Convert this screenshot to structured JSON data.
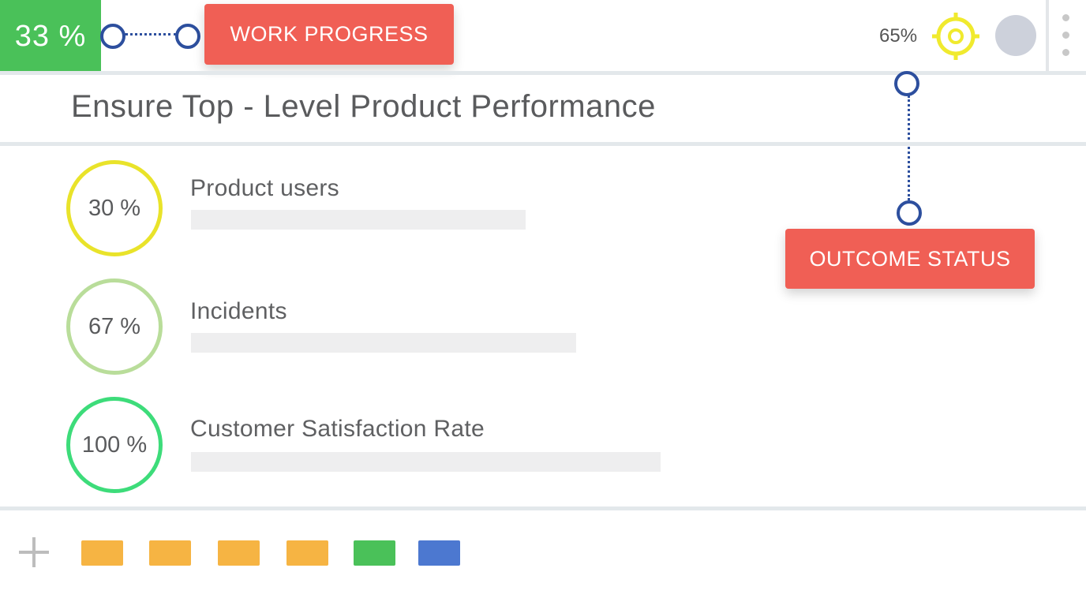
{
  "header": {
    "progress": "33 %",
    "status_percent": "65%"
  },
  "callouts": {
    "work_progress": "WORK PROGRESS",
    "outcome_status": "OUTCOME STATUS"
  },
  "objective": {
    "title": "Ensure Top - Level Product Performance"
  },
  "metrics": [
    {
      "percent": "30 %",
      "label": "Product users",
      "ring_color": "#e9e32a"
    },
    {
      "percent": "67 %",
      "label": "Incidents",
      "ring_color": "#b9dd9a"
    },
    {
      "percent": "100 %",
      "label": "Customer Satisfaction Rate",
      "ring_color": "#3ddc7a"
    }
  ],
  "colors": {
    "progress_green": "#4ac159",
    "callout_red": "#f05f55",
    "connector_blue": "#2d4f9e",
    "target_yellow": "#f0ea2e"
  },
  "footer": {
    "tags": [
      {
        "name": "tag-orange-1",
        "color": "#f6b443"
      },
      {
        "name": "tag-orange-2",
        "color": "#f6b443"
      },
      {
        "name": "tag-orange-3",
        "color": "#f6b443"
      },
      {
        "name": "tag-orange-4",
        "color": "#f6b443"
      },
      {
        "name": "tag-green",
        "color": "#4ac159"
      },
      {
        "name": "tag-blue",
        "color": "#4c78d0"
      }
    ]
  }
}
